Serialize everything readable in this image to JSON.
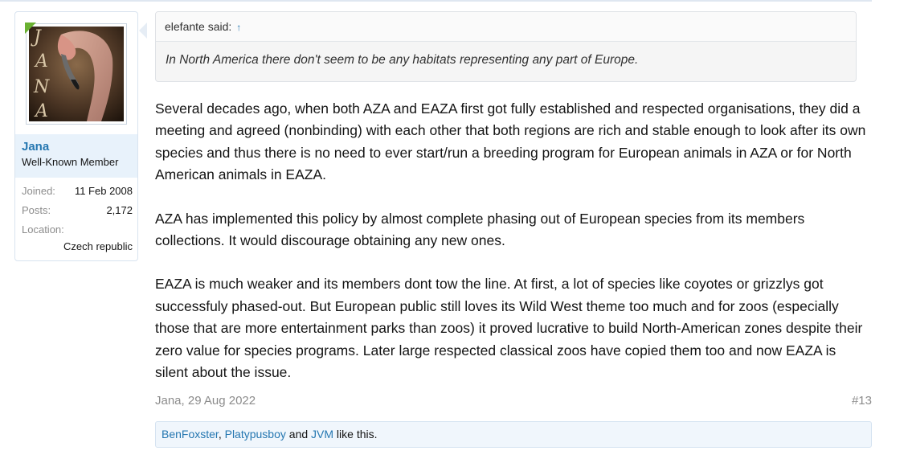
{
  "user": {
    "name": "Jana",
    "title": "Well-Known Member",
    "avatar_letters": [
      "J",
      "A",
      "N",
      "A"
    ],
    "stats": {
      "joined_label": "Joined:",
      "joined_value": "11 Feb 2008",
      "posts_label": "Posts:",
      "posts_value": "2,172",
      "location_label": "Location:",
      "location_value": "Czech republic"
    }
  },
  "quote": {
    "author": "elefante said:",
    "arrow": "↑",
    "text": "In North America there don't seem to be any habitats representing any part of Europe."
  },
  "post": {
    "paragraphs": [
      "Several decades ago, when both AZA and EAZA first got fully established and respected organisations, they did a meeting and agreed (nonbinding) with each other that both regions are rich and stable enough to look after its own species and thus there is no need to ever start/run a breeding program for European animals in AZA or for North American animals in EAZA.",
      "AZA has implemented this policy by almost complete phasing out of European species from its members collections. It would discourage obtaining any new ones.",
      "EAZA is much weaker and its members dont tow the line. At first, a lot of species like coyotes or grizzlys got successfuly phased-out. But European public still loves its Wild West theme too much and for zoos (especially those that are more entertainment parks than zoos) it proved lucrative to build North-American zones despite their zero value for species programs. Later large respected classical zoos have copied them too and now EAZA is silent about the issue."
    ],
    "date": "Jana, 29 Aug 2022",
    "number": "#13"
  },
  "likes": {
    "users": [
      "BenFoxster",
      "Platypusboy",
      "JVM"
    ],
    "separator": ",",
    "and": "and",
    "suffix": "like this."
  },
  "colors": {
    "link": "#2577b1",
    "online_badge": "#6ab131",
    "user_info_bg": "#e8f2fb"
  }
}
